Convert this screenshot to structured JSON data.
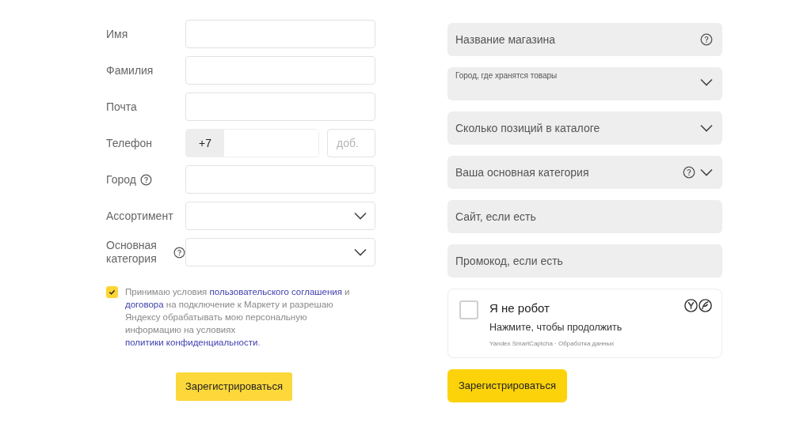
{
  "left_form": {
    "fields": [
      {
        "kind": "text",
        "label": "Имя",
        "help": false
      },
      {
        "kind": "text",
        "label": "Фамилия",
        "help": false
      },
      {
        "kind": "text",
        "label": "Почта",
        "help": false
      },
      {
        "kind": "phone",
        "label": "Телефон",
        "help": false,
        "code": "+7",
        "extension_placeholder": "доб."
      },
      {
        "kind": "text",
        "label": "Город",
        "help": true
      },
      {
        "kind": "select",
        "label": "Ассортимент",
        "help": false
      },
      {
        "kind": "select",
        "label": "Основная категория",
        "help": true
      }
    ],
    "consent": {
      "checked": true,
      "parts": [
        {
          "text": "Принимаю условия ",
          "link": false
        },
        {
          "text": "пользовательского соглашения",
          "link": true
        },
        {
          "text": " и ",
          "link": false
        },
        {
          "text": "договора",
          "link": true
        },
        {
          "text": " на подключение к Маркету и разрешаю Яндексу обрабатывать мою персональную информацию на условиях ",
          "link": false
        },
        {
          "text": "политики конфиденциальности",
          "link": true
        },
        {
          "text": ".",
          "link": false
        }
      ]
    },
    "submit": "Зарегистрироваться"
  },
  "right_form": {
    "fields": [
      {
        "kind": "text",
        "placeholder": "Название магазина",
        "help": true
      },
      {
        "kind": "floating_select",
        "placeholder": "Город, где хранятся товары",
        "help": false
      },
      {
        "kind": "select",
        "placeholder": "Сколько позиций в каталоге",
        "help": false
      },
      {
        "kind": "select",
        "placeholder": "Ваша основная категория",
        "help": true
      },
      {
        "kind": "text",
        "placeholder": "Сайт, если есть",
        "help": false
      },
      {
        "kind": "text",
        "placeholder": "Промокод, если есть",
        "help": false
      }
    ],
    "captcha": {
      "checked": false,
      "title": "Я не робот",
      "subtitle": "Нажмите, чтобы продолжить",
      "footer": "Yandex SmartCaptcha · Обработка данных"
    },
    "submit": "Зарегистрироваться"
  }
}
